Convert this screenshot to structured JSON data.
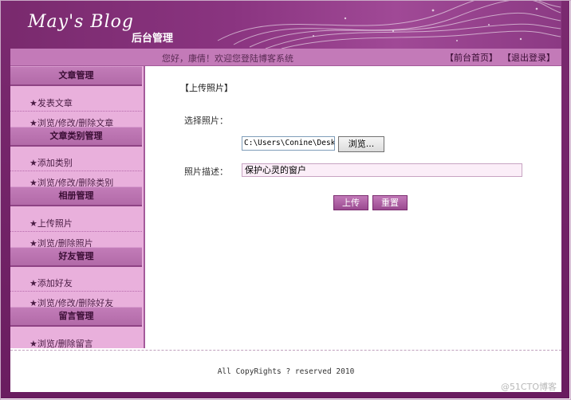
{
  "header": {
    "logo_script": "May's Blog",
    "logo_sub": "后台管理"
  },
  "topbar": {
    "welcome": "您好，康倩！欢迎您登陆博客系统",
    "links": [
      "【前台首页】",
      "【退出登录】"
    ]
  },
  "sidebar": {
    "sections": [
      {
        "title": "文章管理",
        "items": [
          "★发表文章",
          "★浏览/修改/删除文章"
        ]
      },
      {
        "title": "文章类别管理",
        "items": [
          "★添加类别",
          "★浏览/修改/删除类别"
        ]
      },
      {
        "title": "相册管理",
        "items": [
          "★上传照片",
          "★浏览/删除照片"
        ]
      },
      {
        "title": "好友管理",
        "items": [
          "★添加好友",
          "★浏览/修改/删除好友"
        ]
      },
      {
        "title": "留言管理",
        "items": [
          "★浏览/删除留言"
        ]
      }
    ]
  },
  "form": {
    "page_title": "【上传照片】",
    "select_label": "选择照片：",
    "file_value": "C:\\Users\\Conine\\Deskt",
    "browse_label": "浏览...",
    "desc_label": "照片描述：",
    "desc_value": "保护心灵的窗户",
    "submit_label": "上传",
    "reset_label": "重置"
  },
  "footer": {
    "copyright": "All CopyRights ? reserved 2010",
    "watermark": "@51CTO博客"
  },
  "colors": {
    "brand_purple": "#7a2a6e",
    "sidebar_pink": "#e9b0dc",
    "topbar": "#c37ab8"
  }
}
